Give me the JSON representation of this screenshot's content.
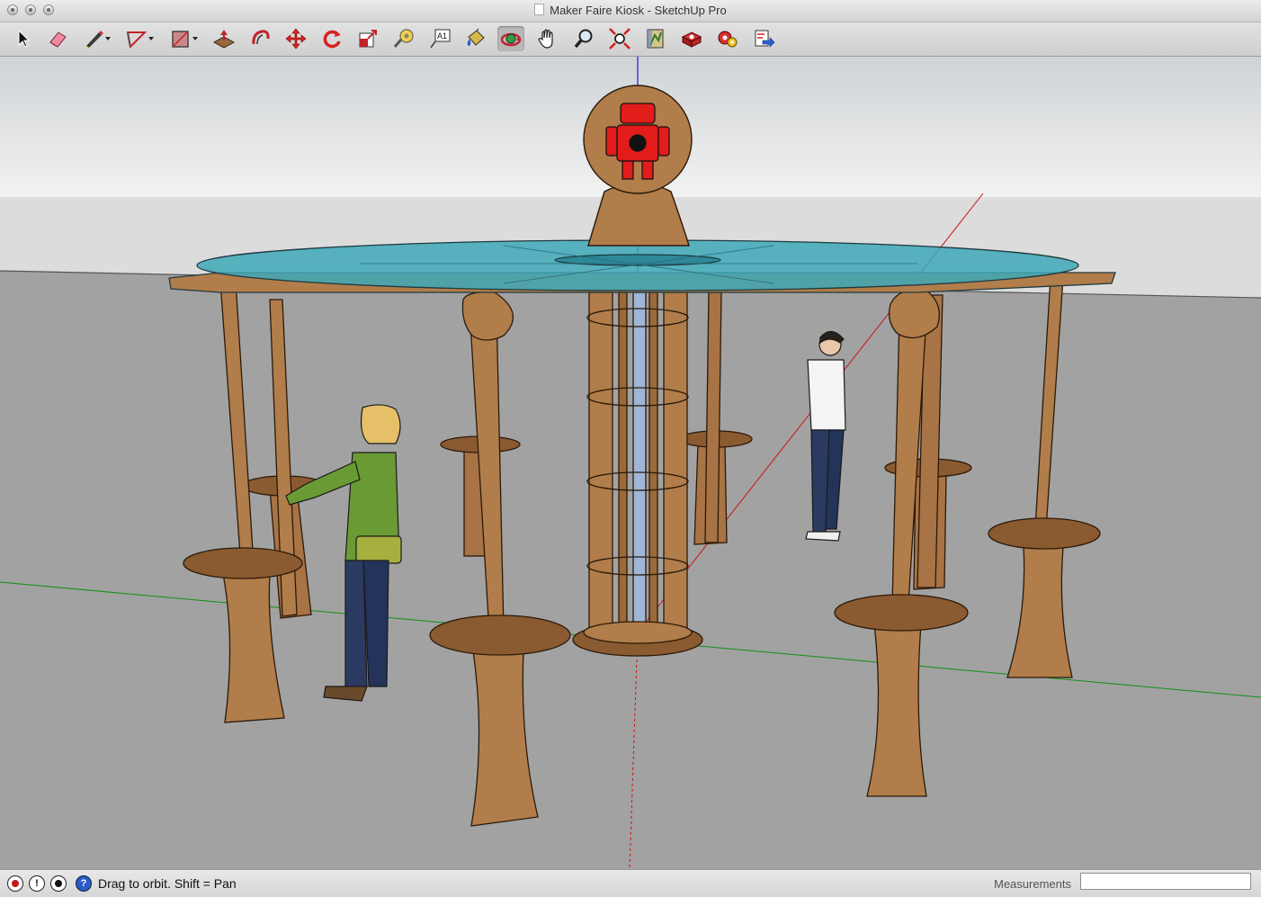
{
  "window": {
    "title": "Maker Faire Kiosk - SketchUp Pro"
  },
  "toolbar": {
    "tools": [
      {
        "icon": "select-arrow-icon"
      },
      {
        "icon": "eraser-icon"
      },
      {
        "icon": "pencil-line-icon"
      },
      {
        "icon": "arc-icon"
      },
      {
        "icon": "rectangle-icon"
      },
      {
        "icon": "push-pull-icon"
      },
      {
        "icon": "offset-icon"
      },
      {
        "icon": "move-icon"
      },
      {
        "icon": "rotate-icon"
      },
      {
        "icon": "scale-icon"
      },
      {
        "icon": "tape-measure-icon"
      },
      {
        "icon": "text-label-icon",
        "label": "A1"
      },
      {
        "icon": "paint-bucket-icon"
      },
      {
        "icon": "orbit-icon",
        "active": true
      },
      {
        "icon": "pan-hand-icon"
      },
      {
        "icon": "zoom-icon"
      },
      {
        "icon": "zoom-extents-icon"
      },
      {
        "icon": "section-plane-icon"
      },
      {
        "icon": "3d-warehouse-icon"
      },
      {
        "icon": "extension-warehouse-icon"
      },
      {
        "icon": "send-to-layout-icon"
      }
    ]
  },
  "status": {
    "hint": "Drag to orbit.  Shift = Pan",
    "measurements_label": "Measurements",
    "measurements_value": "",
    "icons": [
      "geo-location-icon",
      "credits-icon",
      "user-account-icon",
      "help-icon"
    ]
  },
  "colors": {
    "sky": "#e8e8e8",
    "ground": "#a0a0a0",
    "wood": "#b07a45",
    "glass_top": "#3ea8b8",
    "robot_logo": "#e21b1b",
    "axis_red": "#d01010",
    "axis_green": "#109010",
    "axis_blue": "#1010d0"
  }
}
